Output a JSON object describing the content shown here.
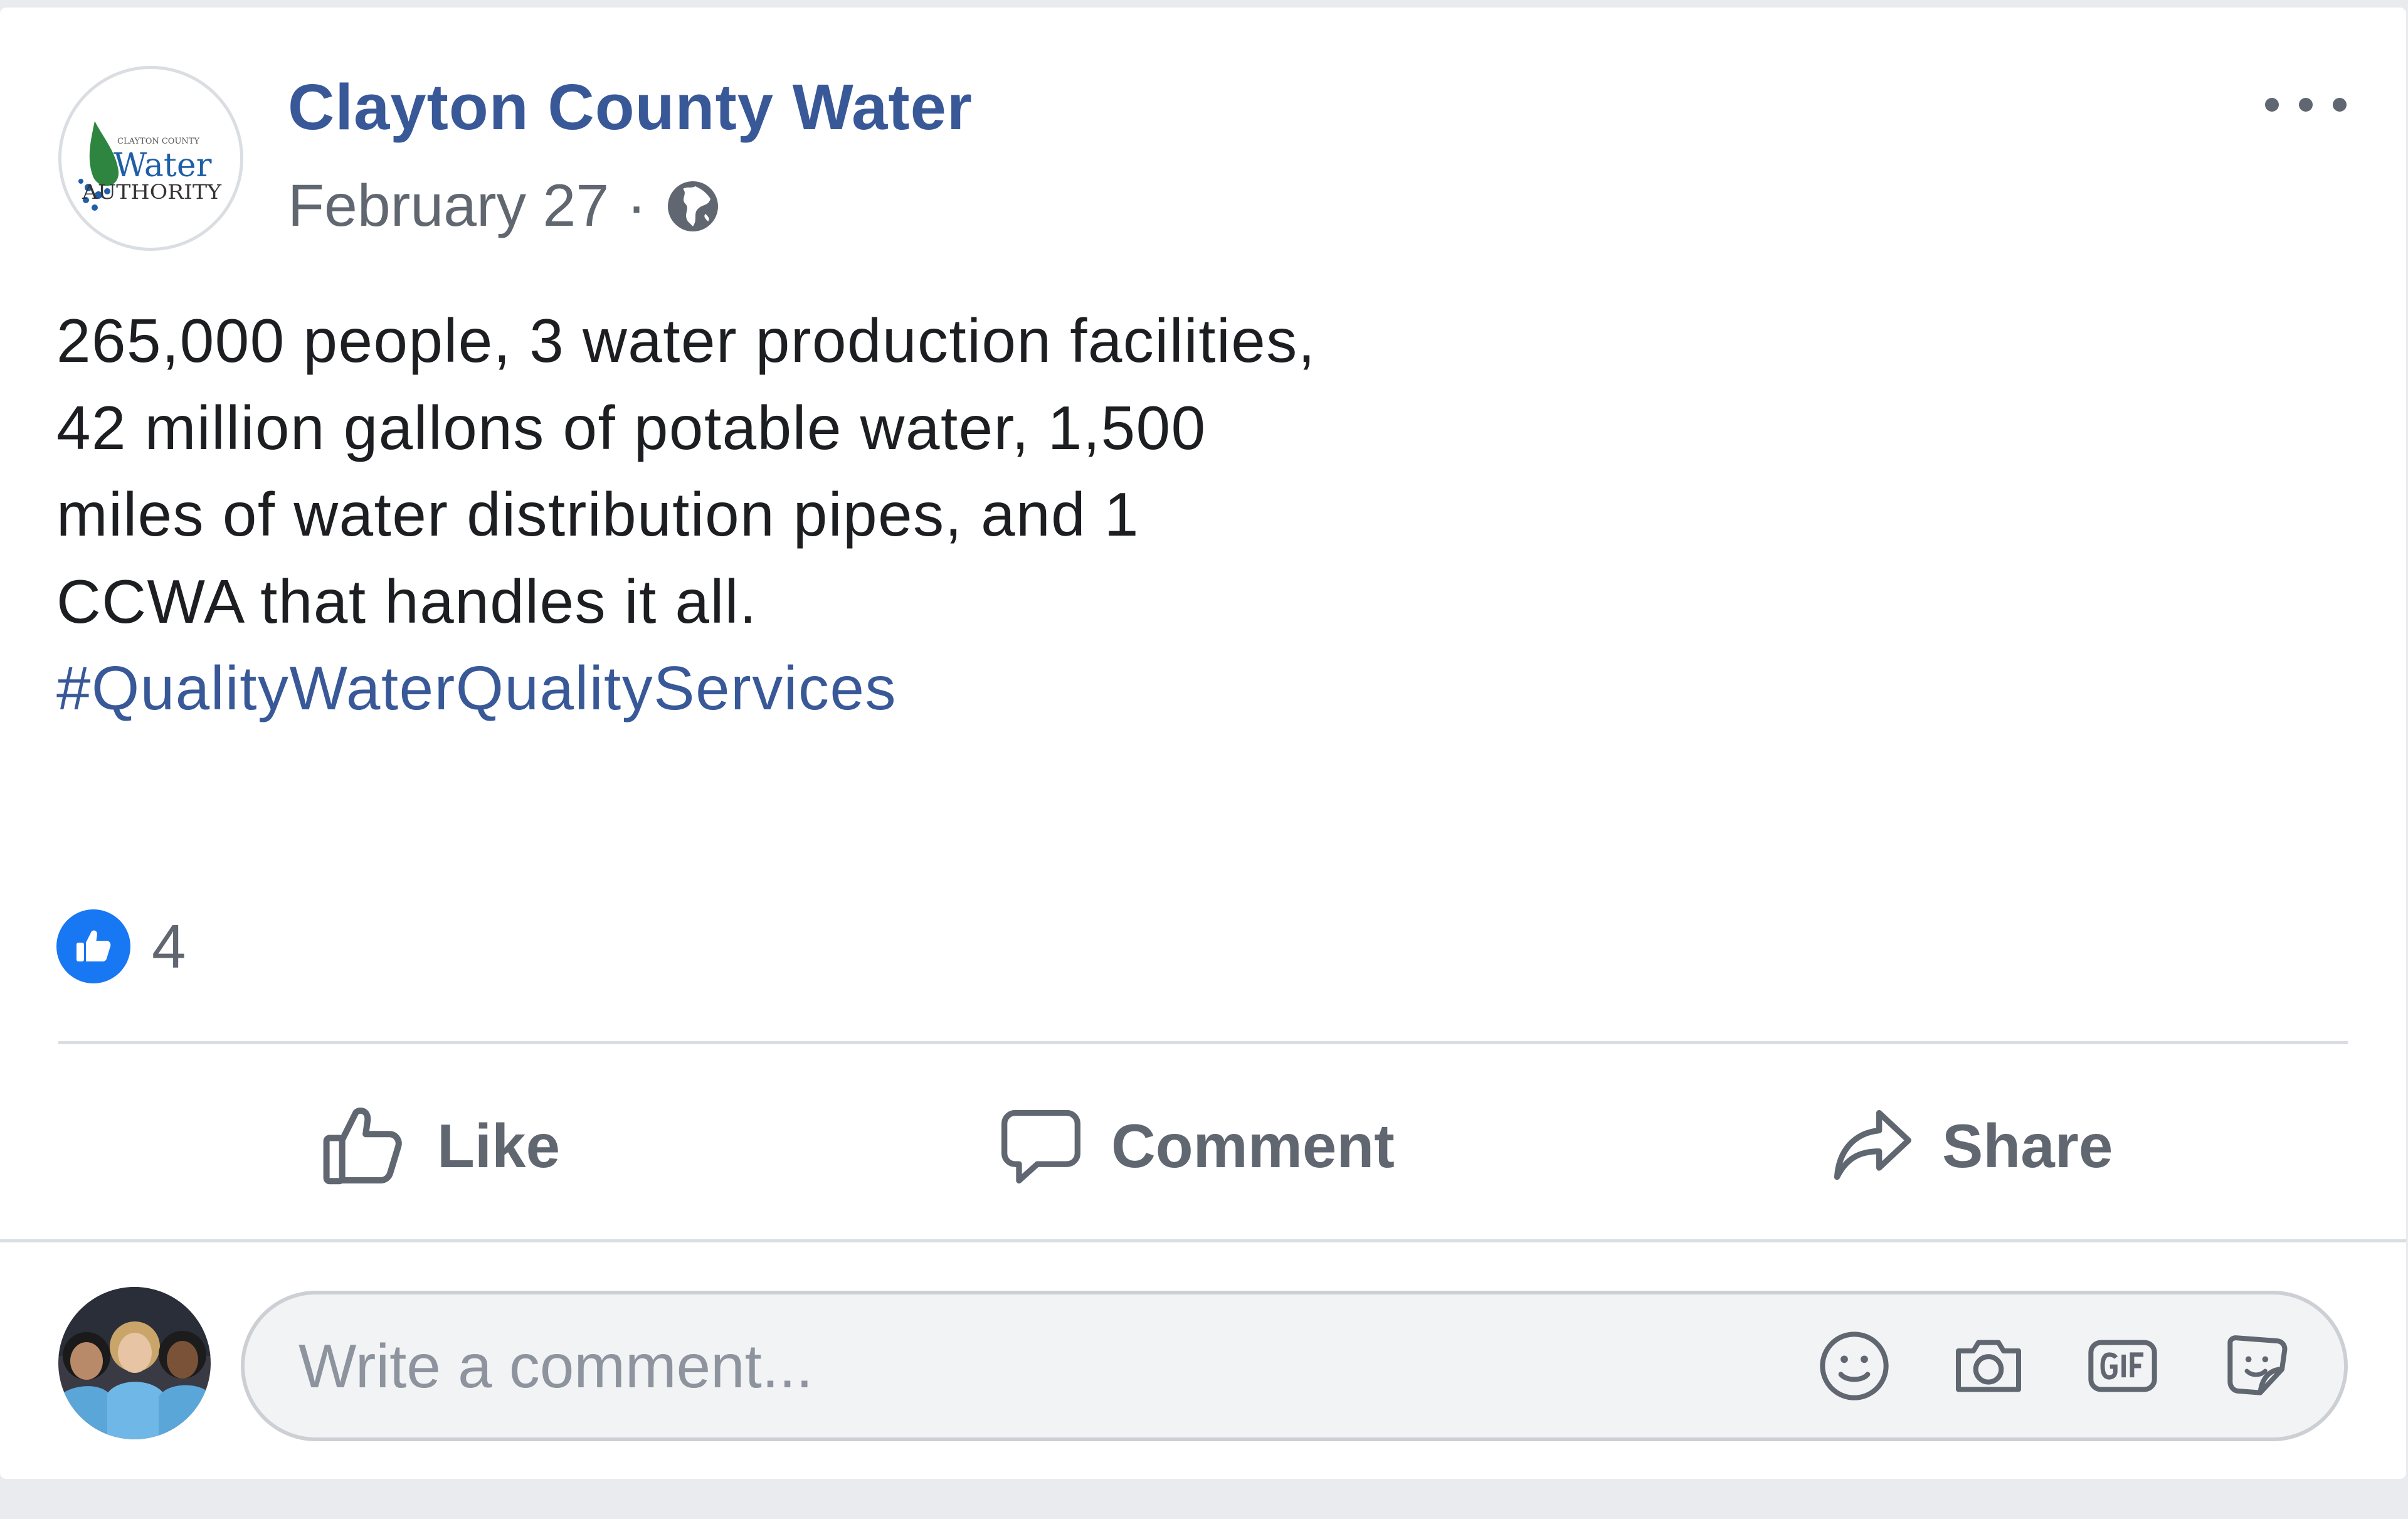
{
  "post": {
    "page_name": "Clayton County Water",
    "date": "February 27",
    "separator": "·",
    "privacy_icon": "globe-icon",
    "more_icon": "more-options-icon",
    "avatar_logo": {
      "top_text": "CLAYTON COUNTY",
      "main_text": "Water",
      "bottom_text": "AUTHORITY"
    },
    "text": "265,000 people, 3 water production facilities, 42 million gallons of potable water, 1,500 miles of water distribution pipes, and 1 CCWA that handles it all.",
    "hashtag": "#QualityWaterQualityServices"
  },
  "reactions": {
    "icon": "like-reaction-icon",
    "count": "4",
    "color": "#1877f2"
  },
  "actions": {
    "like": {
      "label": "Like",
      "icon": "thumbs-up-icon"
    },
    "comment": {
      "label": "Comment",
      "icon": "speech-bubble-icon"
    },
    "share": {
      "label": "Share",
      "icon": "share-arrow-icon"
    }
  },
  "comment_box": {
    "placeholder": "Write a comment...",
    "icons": [
      "emoji-icon",
      "camera-icon",
      "gif-icon",
      "sticker-icon"
    ]
  },
  "colors": {
    "link": "#385898",
    "text": "#1c1e21",
    "muted": "#606770",
    "placeholder": "#8d949e",
    "divider": "#dadde1"
  }
}
